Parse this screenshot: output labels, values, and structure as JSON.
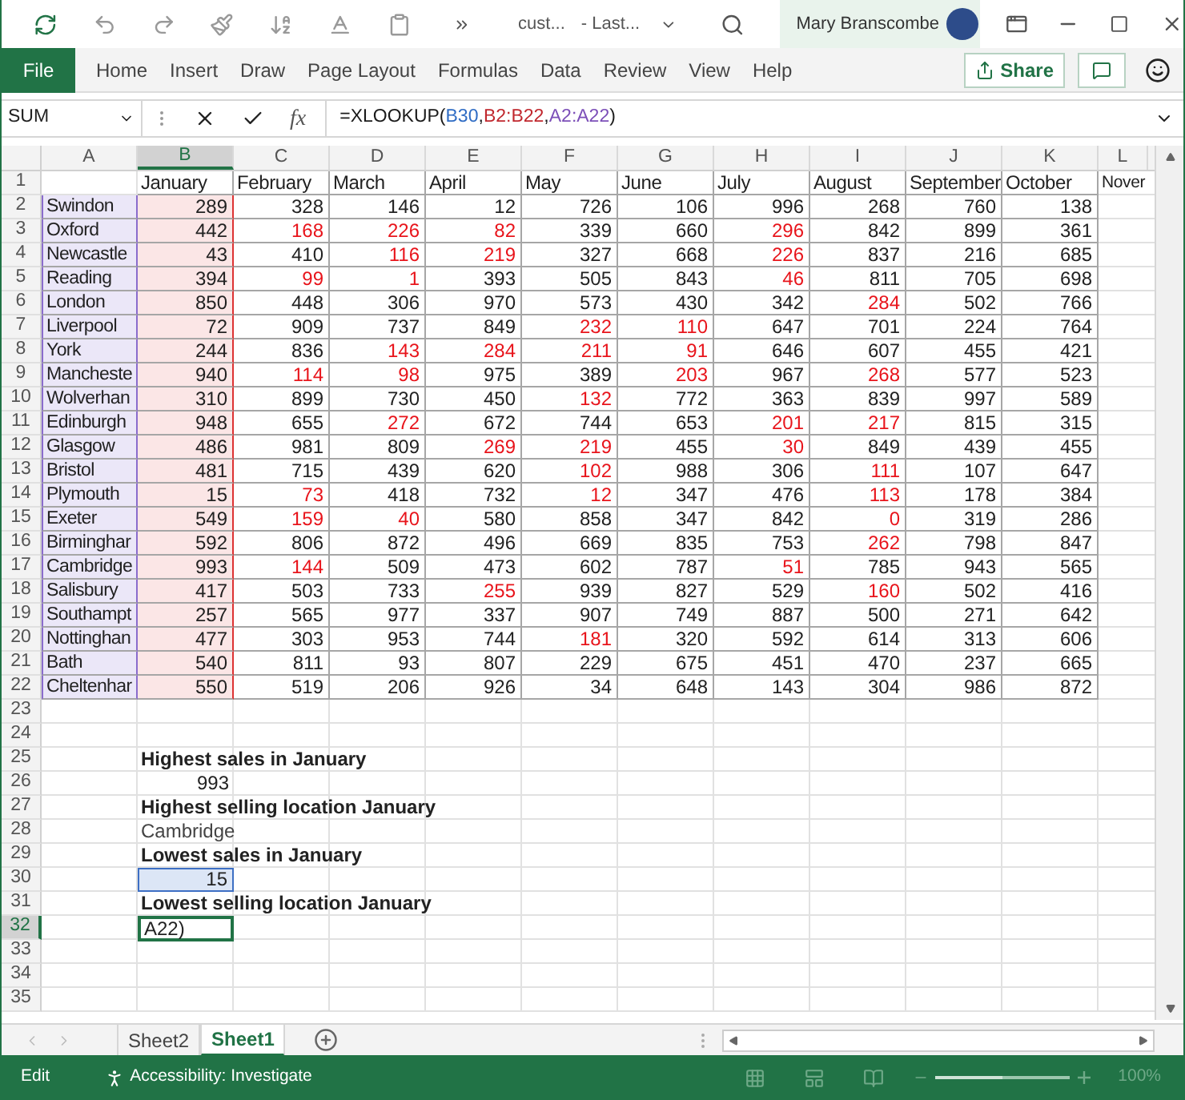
{
  "title_bar": {
    "document": "cust...",
    "location": "- Last...",
    "user": "Mary Branscombe"
  },
  "ribbon": {
    "file_button": "File",
    "tabs": [
      "Home",
      "Insert",
      "Draw",
      "Page Layout",
      "Formulas",
      "Data",
      "Review",
      "View",
      "Help"
    ],
    "share_button": "Share"
  },
  "formula_bar": {
    "name_box": "SUM",
    "function_label": "fx",
    "formula": [
      {
        "text": "=XLOOKUP(",
        "kind": "plain"
      },
      {
        "text": "B30",
        "kind": "reference",
        "color": "#2f6cc4"
      },
      {
        "text": ",",
        "kind": "plain"
      },
      {
        "text": "B2:B22",
        "kind": "reference",
        "color": "#c0282e"
      },
      {
        "text": ",",
        "kind": "plain"
      },
      {
        "text": "A2:A22",
        "kind": "reference",
        "color": "#7c4fb8"
      },
      {
        "text": ")",
        "kind": "plain"
      }
    ]
  },
  "columns": [
    {
      "label": "A",
      "selected": false
    },
    {
      "label": "B",
      "selected": true
    },
    {
      "label": "C",
      "selected": false
    },
    {
      "label": "D",
      "selected": false
    },
    {
      "label": "E",
      "selected": false
    },
    {
      "label": "F",
      "selected": false
    },
    {
      "label": "G",
      "selected": false
    },
    {
      "label": "H",
      "selected": false
    },
    {
      "label": "I",
      "selected": false
    },
    {
      "label": "J",
      "selected": false
    },
    {
      "label": "K",
      "selected": false
    },
    {
      "label": "L",
      "selected": false
    }
  ],
  "header_row": {
    "row": "1",
    "selected": false,
    "months": [
      "January",
      "February",
      "March",
      "April",
      "May",
      "June",
      "July",
      "August",
      "September",
      "October",
      "Nover"
    ]
  },
  "data_rows": [
    {
      "row": "2",
      "selected": false,
      "location": "Swindon",
      "values": [
        {
          "text": "289",
          "low": false
        },
        {
          "text": "328",
          "low": false
        },
        {
          "text": "146",
          "low": false
        },
        {
          "text": "12",
          "low": false
        },
        {
          "text": "726",
          "low": false
        },
        {
          "text": "106",
          "low": false
        },
        {
          "text": "996",
          "low": false
        },
        {
          "text": "268",
          "low": false
        },
        {
          "text": "760",
          "low": false
        },
        {
          "text": "138",
          "low": false
        }
      ]
    },
    {
      "row": "3",
      "selected": false,
      "location": "Oxford",
      "values": [
        {
          "text": "442",
          "low": false
        },
        {
          "text": "168",
          "low": true
        },
        {
          "text": "226",
          "low": true
        },
        {
          "text": "82",
          "low": true
        },
        {
          "text": "339",
          "low": false
        },
        {
          "text": "660",
          "low": false
        },
        {
          "text": "296",
          "low": true
        },
        {
          "text": "842",
          "low": false
        },
        {
          "text": "899",
          "low": false
        },
        {
          "text": "361",
          "low": false
        }
      ]
    },
    {
      "row": "4",
      "selected": false,
      "location": "Newcastle",
      "values": [
        {
          "text": "43",
          "low": false
        },
        {
          "text": "410",
          "low": false
        },
        {
          "text": "116",
          "low": true
        },
        {
          "text": "219",
          "low": true
        },
        {
          "text": "327",
          "low": false
        },
        {
          "text": "668",
          "low": false
        },
        {
          "text": "226",
          "low": true
        },
        {
          "text": "837",
          "low": false
        },
        {
          "text": "216",
          "low": false
        },
        {
          "text": "685",
          "low": false
        }
      ]
    },
    {
      "row": "5",
      "selected": false,
      "location": "Reading",
      "values": [
        {
          "text": "394",
          "low": false
        },
        {
          "text": "99",
          "low": true
        },
        {
          "text": "1",
          "low": true
        },
        {
          "text": "393",
          "low": false
        },
        {
          "text": "505",
          "low": false
        },
        {
          "text": "843",
          "low": false
        },
        {
          "text": "46",
          "low": true
        },
        {
          "text": "811",
          "low": false
        },
        {
          "text": "705",
          "low": false
        },
        {
          "text": "698",
          "low": false
        }
      ]
    },
    {
      "row": "6",
      "selected": false,
      "location": "London",
      "values": [
        {
          "text": "850",
          "low": false
        },
        {
          "text": "448",
          "low": false
        },
        {
          "text": "306",
          "low": false
        },
        {
          "text": "970",
          "low": false
        },
        {
          "text": "573",
          "low": false
        },
        {
          "text": "430",
          "low": false
        },
        {
          "text": "342",
          "low": false
        },
        {
          "text": "284",
          "low": true
        },
        {
          "text": "502",
          "low": false
        },
        {
          "text": "766",
          "low": false
        }
      ]
    },
    {
      "row": "7",
      "selected": false,
      "location": "Liverpool",
      "values": [
        {
          "text": "72",
          "low": false
        },
        {
          "text": "909",
          "low": false
        },
        {
          "text": "737",
          "low": false
        },
        {
          "text": "849",
          "low": false
        },
        {
          "text": "232",
          "low": true
        },
        {
          "text": "110",
          "low": true
        },
        {
          "text": "647",
          "low": false
        },
        {
          "text": "701",
          "low": false
        },
        {
          "text": "224",
          "low": false
        },
        {
          "text": "764",
          "low": false
        }
      ]
    },
    {
      "row": "8",
      "selected": false,
      "location": "York",
      "values": [
        {
          "text": "244",
          "low": false
        },
        {
          "text": "836",
          "low": false
        },
        {
          "text": "143",
          "low": true
        },
        {
          "text": "284",
          "low": true
        },
        {
          "text": "211",
          "low": true
        },
        {
          "text": "91",
          "low": true
        },
        {
          "text": "646",
          "low": false
        },
        {
          "text": "607",
          "low": false
        },
        {
          "text": "455",
          "low": false
        },
        {
          "text": "421",
          "low": false
        }
      ]
    },
    {
      "row": "9",
      "selected": false,
      "location": "Mancheste",
      "values": [
        {
          "text": "940",
          "low": false
        },
        {
          "text": "114",
          "low": true
        },
        {
          "text": "98",
          "low": true
        },
        {
          "text": "975",
          "low": false
        },
        {
          "text": "389",
          "low": false
        },
        {
          "text": "203",
          "low": true
        },
        {
          "text": "967",
          "low": false
        },
        {
          "text": "268",
          "low": true
        },
        {
          "text": "577",
          "low": false
        },
        {
          "text": "523",
          "low": false
        }
      ]
    },
    {
      "row": "10",
      "selected": false,
      "location": "Wolverhan",
      "values": [
        {
          "text": "310",
          "low": false
        },
        {
          "text": "899",
          "low": false
        },
        {
          "text": "730",
          "low": false
        },
        {
          "text": "450",
          "low": false
        },
        {
          "text": "132",
          "low": true
        },
        {
          "text": "772",
          "low": false
        },
        {
          "text": "363",
          "low": false
        },
        {
          "text": "839",
          "low": false
        },
        {
          "text": "997",
          "low": false
        },
        {
          "text": "589",
          "low": false
        }
      ]
    },
    {
      "row": "11",
      "selected": false,
      "location": "Edinburgh",
      "values": [
        {
          "text": "948",
          "low": false
        },
        {
          "text": "655",
          "low": false
        },
        {
          "text": "272",
          "low": true
        },
        {
          "text": "672",
          "low": false
        },
        {
          "text": "744",
          "low": false
        },
        {
          "text": "653",
          "low": false
        },
        {
          "text": "201",
          "low": true
        },
        {
          "text": "217",
          "low": true
        },
        {
          "text": "815",
          "low": false
        },
        {
          "text": "315",
          "low": false
        }
      ]
    },
    {
      "row": "12",
      "selected": false,
      "location": "Glasgow",
      "values": [
        {
          "text": "486",
          "low": false
        },
        {
          "text": "981",
          "low": false
        },
        {
          "text": "809",
          "low": false
        },
        {
          "text": "269",
          "low": true
        },
        {
          "text": "219",
          "low": true
        },
        {
          "text": "455",
          "low": false
        },
        {
          "text": "30",
          "low": true
        },
        {
          "text": "849",
          "low": false
        },
        {
          "text": "439",
          "low": false
        },
        {
          "text": "455",
          "low": false
        }
      ]
    },
    {
      "row": "13",
      "selected": false,
      "location": "Bristol",
      "values": [
        {
          "text": "481",
          "low": false
        },
        {
          "text": "715",
          "low": false
        },
        {
          "text": "439",
          "low": false
        },
        {
          "text": "620",
          "low": false
        },
        {
          "text": "102",
          "low": true
        },
        {
          "text": "988",
          "low": false
        },
        {
          "text": "306",
          "low": false
        },
        {
          "text": "111",
          "low": true
        },
        {
          "text": "107",
          "low": false
        },
        {
          "text": "647",
          "low": false
        }
      ]
    },
    {
      "row": "14",
      "selected": false,
      "location": "Plymouth",
      "values": [
        {
          "text": "15",
          "low": false
        },
        {
          "text": "73",
          "low": true
        },
        {
          "text": "418",
          "low": false
        },
        {
          "text": "732",
          "low": false
        },
        {
          "text": "12",
          "low": true
        },
        {
          "text": "347",
          "low": false
        },
        {
          "text": "476",
          "low": false
        },
        {
          "text": "113",
          "low": true
        },
        {
          "text": "178",
          "low": false
        },
        {
          "text": "384",
          "low": false
        }
      ]
    },
    {
      "row": "15",
      "selected": false,
      "location": "Exeter",
      "values": [
        {
          "text": "549",
          "low": false
        },
        {
          "text": "159",
          "low": true
        },
        {
          "text": "40",
          "low": true
        },
        {
          "text": "580",
          "low": false
        },
        {
          "text": "858",
          "low": false
        },
        {
          "text": "347",
          "low": false
        },
        {
          "text": "842",
          "low": false
        },
        {
          "text": "0",
          "low": true
        },
        {
          "text": "319",
          "low": false
        },
        {
          "text": "286",
          "low": false
        }
      ]
    },
    {
      "row": "16",
      "selected": false,
      "location": "Birminghar",
      "values": [
        {
          "text": "592",
          "low": false
        },
        {
          "text": "806",
          "low": false
        },
        {
          "text": "872",
          "low": false
        },
        {
          "text": "496",
          "low": false
        },
        {
          "text": "669",
          "low": false
        },
        {
          "text": "835",
          "low": false
        },
        {
          "text": "753",
          "low": false
        },
        {
          "text": "262",
          "low": true
        },
        {
          "text": "798",
          "low": false
        },
        {
          "text": "847",
          "low": false
        }
      ]
    },
    {
      "row": "17",
      "selected": false,
      "location": "Cambridge",
      "values": [
        {
          "text": "993",
          "low": false
        },
        {
          "text": "144",
          "low": true
        },
        {
          "text": "509",
          "low": false
        },
        {
          "text": "473",
          "low": false
        },
        {
          "text": "602",
          "low": false
        },
        {
          "text": "787",
          "low": false
        },
        {
          "text": "51",
          "low": true
        },
        {
          "text": "785",
          "low": false
        },
        {
          "text": "943",
          "low": false
        },
        {
          "text": "565",
          "low": false
        }
      ]
    },
    {
      "row": "18",
      "selected": false,
      "location": "Salisbury",
      "values": [
        {
          "text": "417",
          "low": false
        },
        {
          "text": "503",
          "low": false
        },
        {
          "text": "733",
          "low": false
        },
        {
          "text": "255",
          "low": true
        },
        {
          "text": "939",
          "low": false
        },
        {
          "text": "827",
          "low": false
        },
        {
          "text": "529",
          "low": false
        },
        {
          "text": "160",
          "low": true
        },
        {
          "text": "502",
          "low": false
        },
        {
          "text": "416",
          "low": false
        }
      ]
    },
    {
      "row": "19",
      "selected": false,
      "location": "Southampt",
      "values": [
        {
          "text": "257",
          "low": false
        },
        {
          "text": "565",
          "low": false
        },
        {
          "text": "977",
          "low": false
        },
        {
          "text": "337",
          "low": false
        },
        {
          "text": "907",
          "low": false
        },
        {
          "text": "749",
          "low": false
        },
        {
          "text": "887",
          "low": false
        },
        {
          "text": "500",
          "low": false
        },
        {
          "text": "271",
          "low": false
        },
        {
          "text": "642",
          "low": false
        }
      ]
    },
    {
      "row": "20",
      "selected": false,
      "location": "Nottinghan",
      "values": [
        {
          "text": "477",
          "low": false
        },
        {
          "text": "303",
          "low": false
        },
        {
          "text": "953",
          "low": false
        },
        {
          "text": "744",
          "low": false
        },
        {
          "text": "181",
          "low": true
        },
        {
          "text": "320",
          "low": false
        },
        {
          "text": "592",
          "low": false
        },
        {
          "text": "614",
          "low": false
        },
        {
          "text": "313",
          "low": false
        },
        {
          "text": "606",
          "low": false
        }
      ]
    },
    {
      "row": "21",
      "selected": false,
      "location": "Bath",
      "values": [
        {
          "text": "540",
          "low": false
        },
        {
          "text": "811",
          "low": false
        },
        {
          "text": "93",
          "low": false
        },
        {
          "text": "807",
          "low": false
        },
        {
          "text": "229",
          "low": false
        },
        {
          "text": "675",
          "low": false
        },
        {
          "text": "451",
          "low": false
        },
        {
          "text": "470",
          "low": false
        },
        {
          "text": "237",
          "low": false
        },
        {
          "text": "665",
          "low": false
        }
      ]
    },
    {
      "row": "22",
      "selected": false,
      "location": "Cheltenhar",
      "values": [
        {
          "text": "550",
          "low": false
        },
        {
          "text": "519",
          "low": false
        },
        {
          "text": "206",
          "low": false
        },
        {
          "text": "926",
          "low": false
        },
        {
          "text": "34",
          "low": false
        },
        {
          "text": "648",
          "low": false
        },
        {
          "text": "143",
          "low": false
        },
        {
          "text": "304",
          "low": false
        },
        {
          "text": "986",
          "low": false
        },
        {
          "text": "872",
          "low": false
        }
      ]
    }
  ],
  "summary_rows": [
    {
      "row": "23",
      "selected": false
    },
    {
      "row": "24",
      "selected": false
    },
    {
      "row": "25",
      "selected": false,
      "cell": {
        "kind": "heading",
        "text": "Highest sales in January"
      }
    },
    {
      "row": "26",
      "selected": false,
      "cell": {
        "kind": "number",
        "text": "993"
      }
    },
    {
      "row": "27",
      "selected": false,
      "cell": {
        "kind": "heading",
        "text": "Highest selling location January"
      }
    },
    {
      "row": "28",
      "selected": false,
      "cell": {
        "kind": "text",
        "text": "Cambridge"
      }
    },
    {
      "row": "29",
      "selected": false,
      "cell": {
        "kind": "heading",
        "text": "Lowest sales in January"
      }
    },
    {
      "row": "30",
      "selected": false,
      "cell": {
        "kind": "reference",
        "text": "15"
      }
    },
    {
      "row": "31",
      "selected": false,
      "cell": {
        "kind": "heading",
        "text": "Lowest selling location January"
      }
    },
    {
      "row": "32",
      "selected": true,
      "cell": {
        "kind": "editing",
        "text": "A22)"
      }
    },
    {
      "row": "33",
      "selected": false
    },
    {
      "row": "34",
      "selected": false
    },
    {
      "row": "35",
      "selected": false
    }
  ],
  "sheet_tabs": [
    {
      "label": "Sheet2",
      "selected": false
    },
    {
      "label": "Sheet1",
      "selected": true
    }
  ],
  "status_bar": {
    "mode": "Edit",
    "accessibility": "Accessibility: Investigate",
    "zoom": {
      "level": 0.5,
      "reading": "100%"
    }
  }
}
